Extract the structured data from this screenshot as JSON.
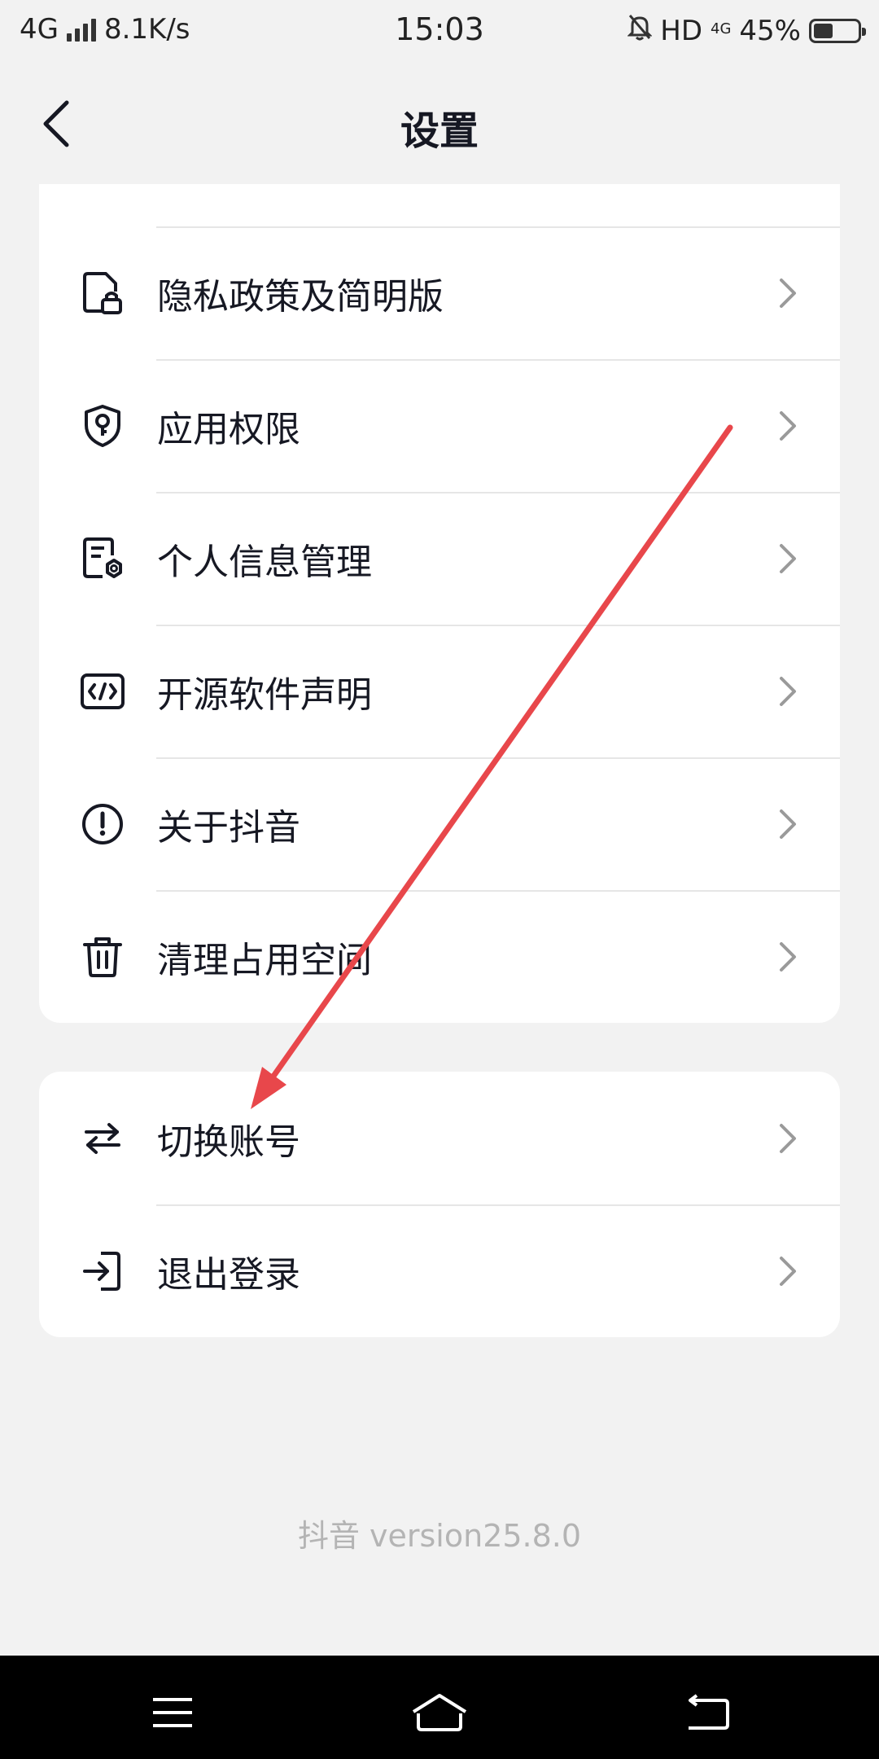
{
  "status_bar": {
    "network": "4G",
    "speed": "8.1K/s",
    "time": "15:03",
    "hd": "HD",
    "data_type": "4G",
    "battery_percent": "45%",
    "battery_level": 0.45,
    "icons": [
      "signal-icon",
      "bell-off-icon",
      "battery-icon"
    ]
  },
  "header": {
    "title": "设置",
    "back_icon": "chevron-left-icon"
  },
  "settings_group_1": {
    "items": [
      {
        "label": "隐私政策及简明版",
        "icon": "document-lock-icon"
      },
      {
        "label": "应用权限",
        "icon": "shield-key-icon"
      },
      {
        "label": "个人信息管理",
        "icon": "document-gear-icon"
      },
      {
        "label": "开源软件声明",
        "icon": "code-icon"
      },
      {
        "label": "关于抖音",
        "icon": "info-exclamation-icon"
      },
      {
        "label": "清理占用空间",
        "icon": "trash-icon"
      }
    ]
  },
  "settings_group_2": {
    "items": [
      {
        "label": "切换账号",
        "icon": "switch-arrows-icon"
      },
      {
        "label": "退出登录",
        "icon": "logout-icon"
      }
    ]
  },
  "footer": {
    "version": "抖音 version25.8.0"
  },
  "nav_bar": {
    "buttons": [
      "menu-icon",
      "home-icon",
      "back-icon"
    ]
  },
  "colors": {
    "background": "#f2f2f2",
    "card": "#ffffff",
    "text": "#161823",
    "chevron": "#9a9a9a",
    "version_text": "#b4b4b4",
    "annotation_arrow": "#e8474b"
  }
}
